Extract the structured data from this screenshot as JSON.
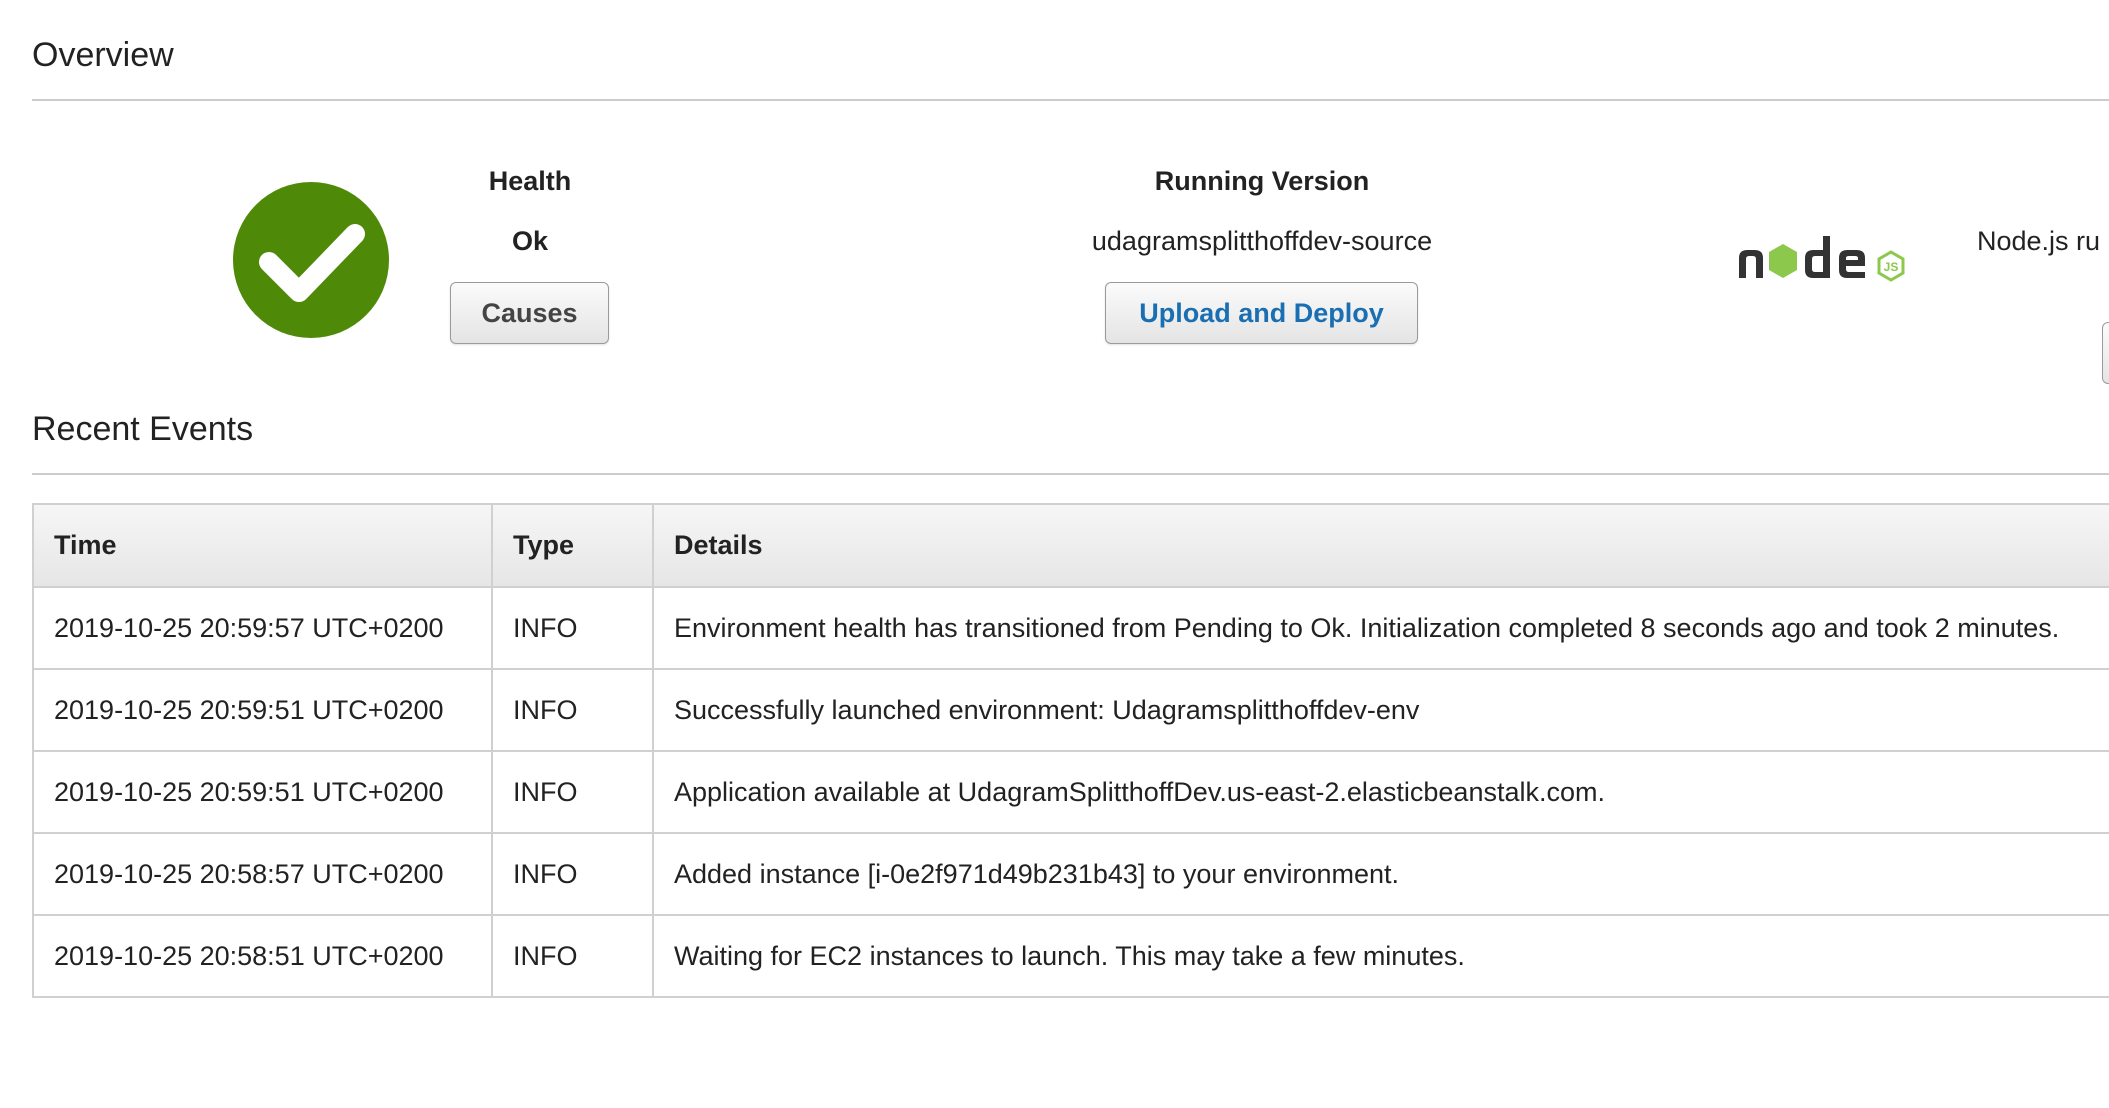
{
  "overview": {
    "title": "Overview",
    "health": {
      "label": "Health",
      "value": "Ok",
      "status_color": "#4e8a08",
      "icon": "check-circle-icon",
      "causes_label": "Causes"
    },
    "running_version": {
      "label": "Running Version",
      "value": "udagramsplitthoffdev-source",
      "deploy_label": "Upload and Deploy"
    },
    "platform": {
      "logo": "node-js-logo",
      "text": "Node.js ru"
    }
  },
  "events": {
    "title": "Recent Events",
    "columns": [
      "Time",
      "Type",
      "Details"
    ],
    "rows": [
      {
        "time": "2019-10-25 20:59:57 UTC+0200",
        "type": "INFO",
        "details": "Environment health has transitioned from Pending to Ok. Initialization completed 8 seconds ago and took 2 minutes."
      },
      {
        "time": "2019-10-25 20:59:51 UTC+0200",
        "type": "INFO",
        "details": "Successfully launched environment: Udagramsplitthoffdev-env"
      },
      {
        "time": "2019-10-25 20:59:51 UTC+0200",
        "type": "INFO",
        "details": "Application available at UdagramSplitthoffDev.us-east-2.elasticbeanstalk.com."
      },
      {
        "time": "2019-10-25 20:58:57 UTC+0200",
        "type": "INFO",
        "details": "Added instance [i-0e2f971d49b231b43] to your environment."
      },
      {
        "time": "2019-10-25 20:58:51 UTC+0200",
        "type": "INFO",
        "details": "Waiting for EC2 instances to launch. This may take a few minutes."
      }
    ]
  },
  "colors": {
    "info": "#4e8a08",
    "link": "#1a6fb3",
    "node_green": "#8cc84b",
    "node_dark": "#333333"
  }
}
